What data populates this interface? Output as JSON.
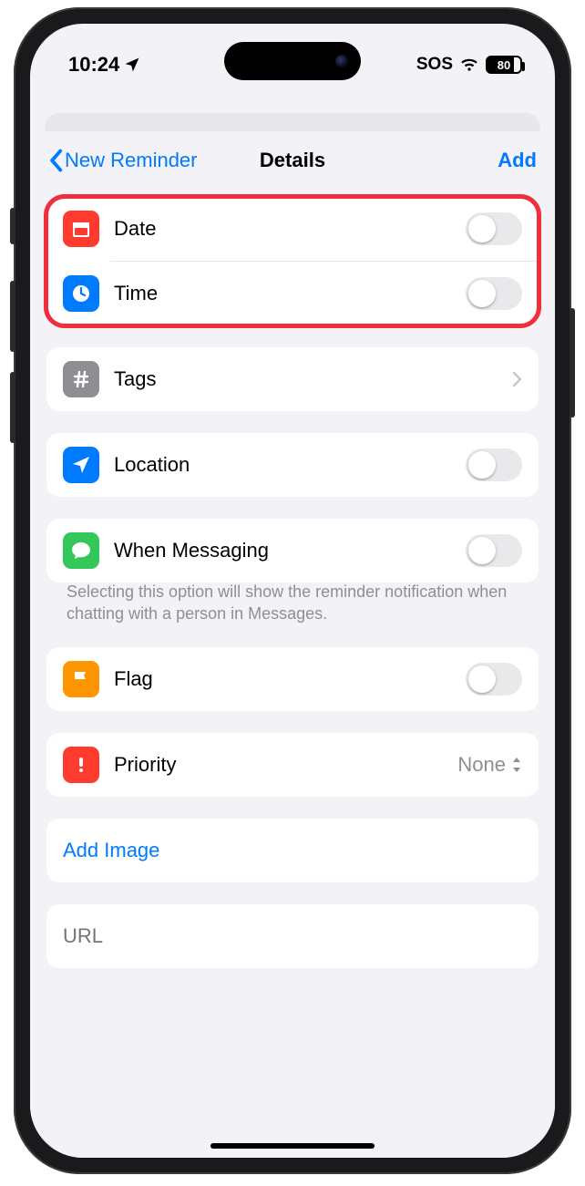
{
  "status": {
    "time": "10:24",
    "sos": "SOS",
    "battery": "80"
  },
  "nav": {
    "back": "New Reminder",
    "title": "Details",
    "add": "Add"
  },
  "rows": {
    "date": {
      "label": "Date"
    },
    "time": {
      "label": "Time"
    },
    "tags": {
      "label": "Tags"
    },
    "location": {
      "label": "Location"
    },
    "messaging": {
      "label": "When Messaging"
    },
    "messaging_note": "Selecting this option will show the reminder notification when chatting with a person in Messages.",
    "flag": {
      "label": "Flag"
    },
    "priority": {
      "label": "Priority",
      "value": "None"
    },
    "add_image": "Add Image",
    "url_placeholder": "URL"
  },
  "colors": {
    "date": "#ff3b30",
    "time": "#007aff",
    "tags": "#8e8e93",
    "location": "#007aff",
    "messaging": "#34c759",
    "flag": "#ff9500",
    "priority": "#ff3b30"
  }
}
